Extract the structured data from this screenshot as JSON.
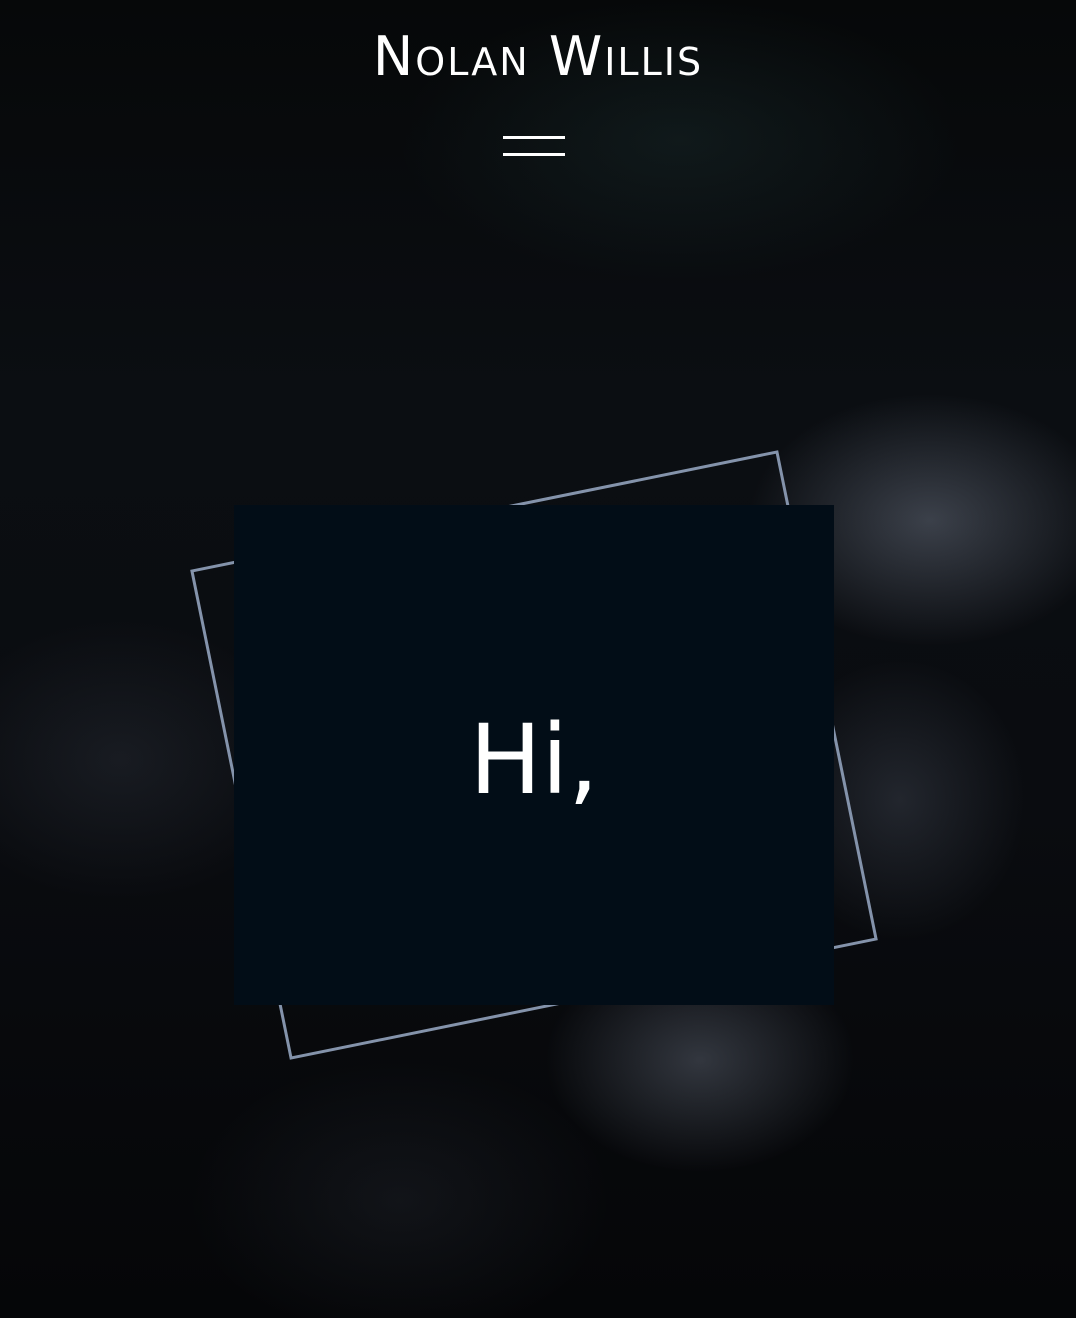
{
  "header": {
    "site_title": "Nolan Willis",
    "menu_icon": "hamburger-menu-icon"
  },
  "hero": {
    "greeting": "Hi,"
  },
  "colors": {
    "background": "#05070b",
    "card": "#020d17",
    "frame_outline": "#8493ab",
    "text": "#ffffff"
  }
}
